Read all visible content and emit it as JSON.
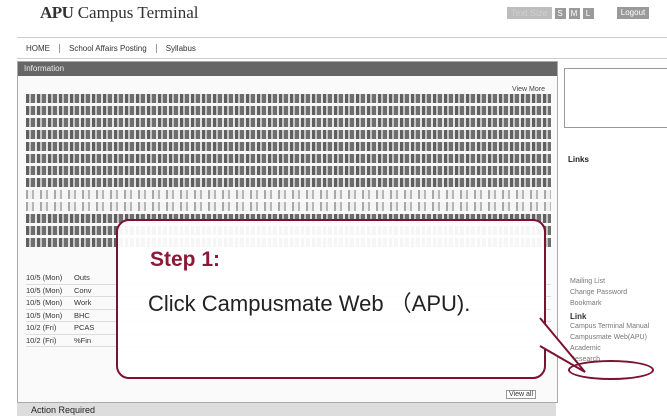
{
  "header": {
    "logo_mark": "APU",
    "logo_text": "Campus Terminal",
    "textsize_label": "Text Size",
    "size_small": "S",
    "size_medium": "M",
    "size_large": "L",
    "logout": "Logout"
  },
  "nav": [
    "HOME",
    "School Affairs Posting",
    "Syllabus"
  ],
  "main": {
    "panel_title": "Information",
    "view_more": "View More",
    "news": [
      {
        "date": "10/5 (Mon)",
        "text": "Outs"
      },
      {
        "date": "10/5 (Mon)",
        "text": "Conv"
      },
      {
        "date": "10/5 (Mon)",
        "text": "Work"
      },
      {
        "date": "10/5 (Mon)",
        "text": "BHC"
      },
      {
        "date": "10/2 (Fri)",
        "text": "PCAS"
      },
      {
        "date": "10/2 (Fri)",
        "text": "%Fin"
      }
    ],
    "view_all": "View all"
  },
  "action_required": "Action Required",
  "right": {
    "links_header": "Links",
    "links": [
      "Mailing List",
      "Change Password",
      "Bookmark"
    ],
    "link2_header": "Link",
    "links2": [
      "Campus Terminal Manual",
      "Campusmate Web(APU)",
      "Academic",
      "Research"
    ]
  },
  "callout": {
    "step": "Step 1:",
    "instruction": "Click Campusmate Web （APU)."
  }
}
